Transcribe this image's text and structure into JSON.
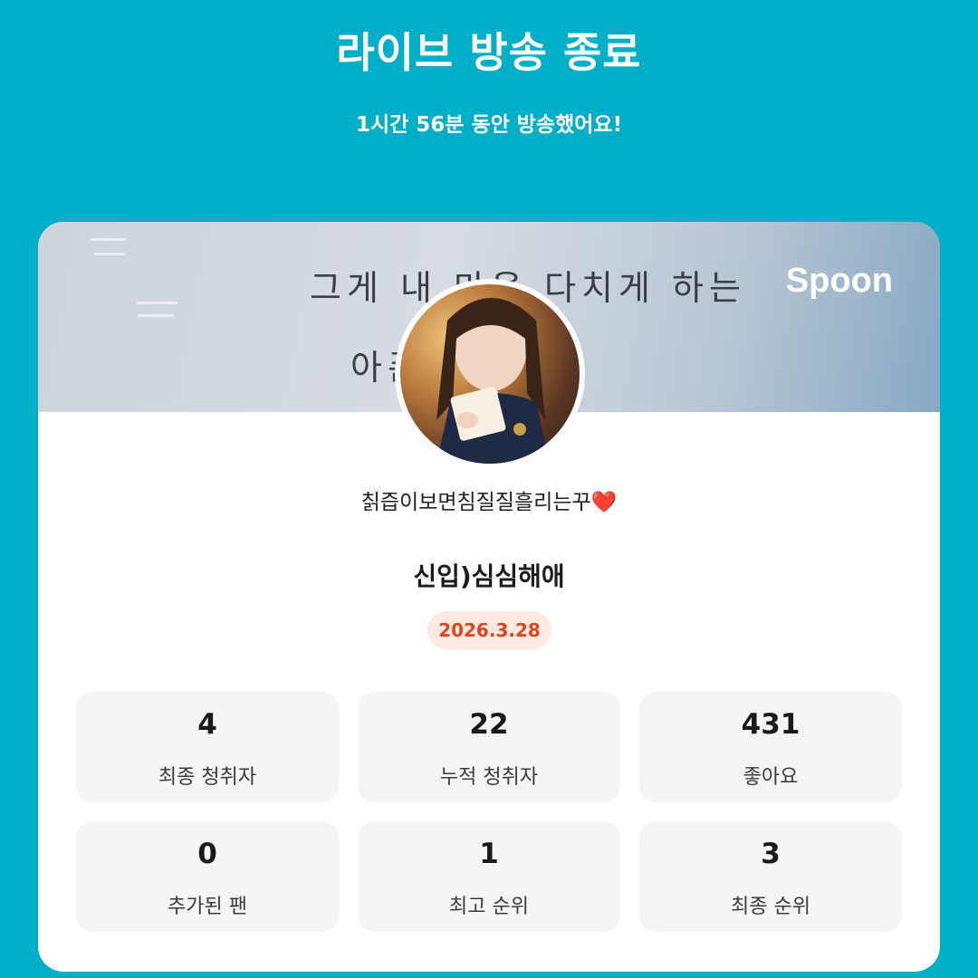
{
  "header": {
    "title": "라이브 방송 종료",
    "subtitle": "1시간 56분 동안 방송했어요!"
  },
  "banner": {
    "line1": "그게 내 마음 다치게 하는",
    "line2": "아픈          모르고",
    "brand": "Spoon"
  },
  "profile": {
    "nickname": "칡즙이보면침질질흘리는꾸",
    "heart": "❤️"
  },
  "broadcast": {
    "title": "신입)심심해애",
    "date": "2026.3.28"
  },
  "stats": [
    {
      "value": "4",
      "label": "최종 청취자"
    },
    {
      "value": "22",
      "label": "누적 청취자"
    },
    {
      "value": "431",
      "label": "좋아요"
    },
    {
      "value": "0",
      "label": "추가된 팬"
    },
    {
      "value": "1",
      "label": "최고 순위"
    },
    {
      "value": "3",
      "label": "최종 순위"
    }
  ],
  "colors": {
    "background": "#00aec8",
    "card": "#ffffff",
    "date_badge_bg": "#fde9e2",
    "date_badge_text": "#e0461c",
    "stat_bg": "#f5f5f5"
  }
}
